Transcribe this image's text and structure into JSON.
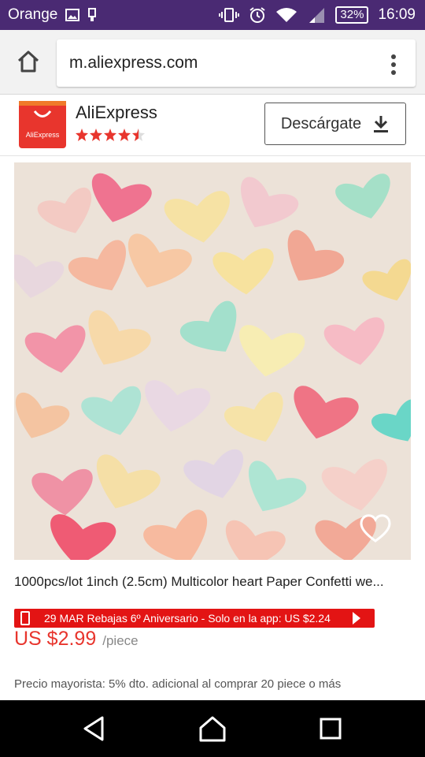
{
  "status_bar": {
    "carrier": "Orange",
    "battery": "32%",
    "time": "16:09"
  },
  "browser": {
    "url": "m.aliexpress.com"
  },
  "app_banner": {
    "logo_text": "AliExpress",
    "app_name": "AliExpress",
    "rating": 4.5,
    "download_label": "Descárgate"
  },
  "product": {
    "title": "1000pcs/lot 1inch (2.5cm) Multicolor heart Paper Confetti we...",
    "promo_text": "29 MAR Rebajas 6º Aniversario - Solo en la app: US $2.24",
    "price": "US $2.99",
    "unit": "/piece",
    "wholesale": "Precio mayorista: 5% dto. adicional al comprar 20 piece o más"
  },
  "colors": {
    "status_bar": "#4a2a73",
    "brand_red": "#e8352d",
    "promo_red": "#e31414"
  }
}
